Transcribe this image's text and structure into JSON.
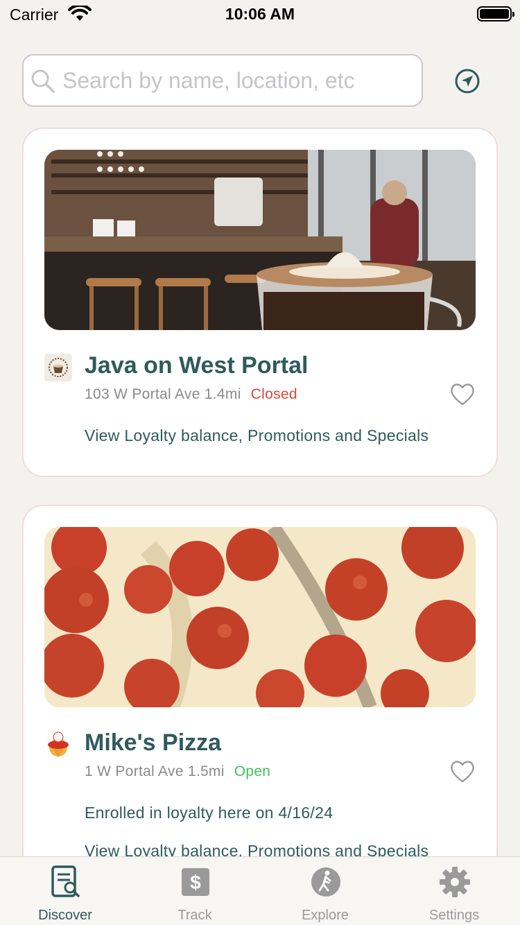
{
  "status_bar": {
    "carrier": "Carrier",
    "time": "10:06 AM"
  },
  "search": {
    "placeholder": "Search by name, location, etc",
    "icon": "search-icon",
    "locate_icon": "location-arrow-icon"
  },
  "places": [
    {
      "name": "Java on West Portal",
      "address": "103 W Portal Ave 1.4mi",
      "status": "Closed",
      "status_color": "#e0453a",
      "link": "View Loyalty balance, Promotions and Specials",
      "image": "cafe-photo"
    },
    {
      "name": "Mike's Pizza",
      "address": "1 W Portal Ave 1.5mi",
      "status": "Open",
      "status_color": "#3fbf57",
      "enrolled": "Enrolled in loyalty here on 4/16/24",
      "link": "View Loyalty balance, Promotions and Specials",
      "image": "pizza-photo"
    }
  ],
  "tabs": [
    {
      "label": "Discover",
      "icon": "discover-icon",
      "active": true
    },
    {
      "label": "Track",
      "icon": "dollar-icon",
      "active": false
    },
    {
      "label": "Explore",
      "icon": "walking-icon",
      "active": false
    },
    {
      "label": "Settings",
      "icon": "gear-icon",
      "active": false
    }
  ],
  "colors": {
    "accent": "#2f5a5c",
    "background": "#f3f2ef",
    "closed": "#e0453a",
    "open": "#3fbf57",
    "inactive_tab": "#9a9a9a"
  }
}
